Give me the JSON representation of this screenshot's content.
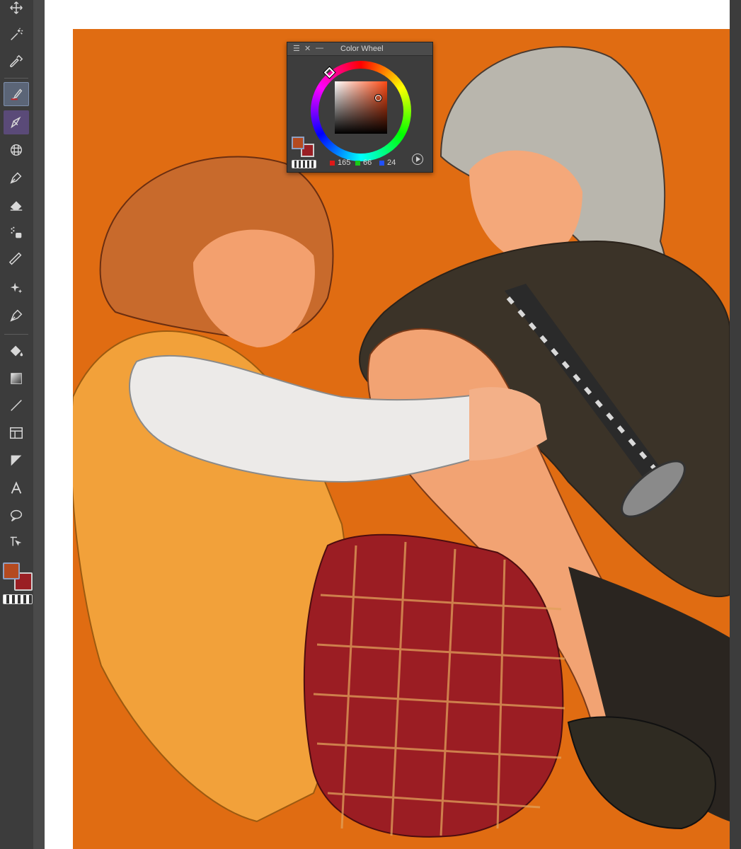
{
  "color_wheel": {
    "title": "Color Wheel",
    "rgb": {
      "r": "165",
      "g": "66",
      "b": "24"
    }
  },
  "colors": {
    "foreground": "#b44a20",
    "background": "#9a1f24",
    "canvas_bg": "#e06c12",
    "toolbar_bg": "#3c3c3c",
    "active_tool": "#5b6577"
  },
  "tools": [
    "move-icon",
    "magic-wand-icon",
    "eyedropper-icon",
    "brush-icon",
    "pen-nib-icon",
    "perspective-grid-icon",
    "pen-icon",
    "eraser-icon",
    "blend-icon",
    "ruler-icon",
    "sparkle-icon",
    "fountain-pen-icon",
    "fill-bucket-icon",
    "gradient-icon",
    "line-icon",
    "frame-icon",
    "ruler-corner-icon",
    "text-icon",
    "speech-balloon-icon",
    "object-select-icon"
  ]
}
